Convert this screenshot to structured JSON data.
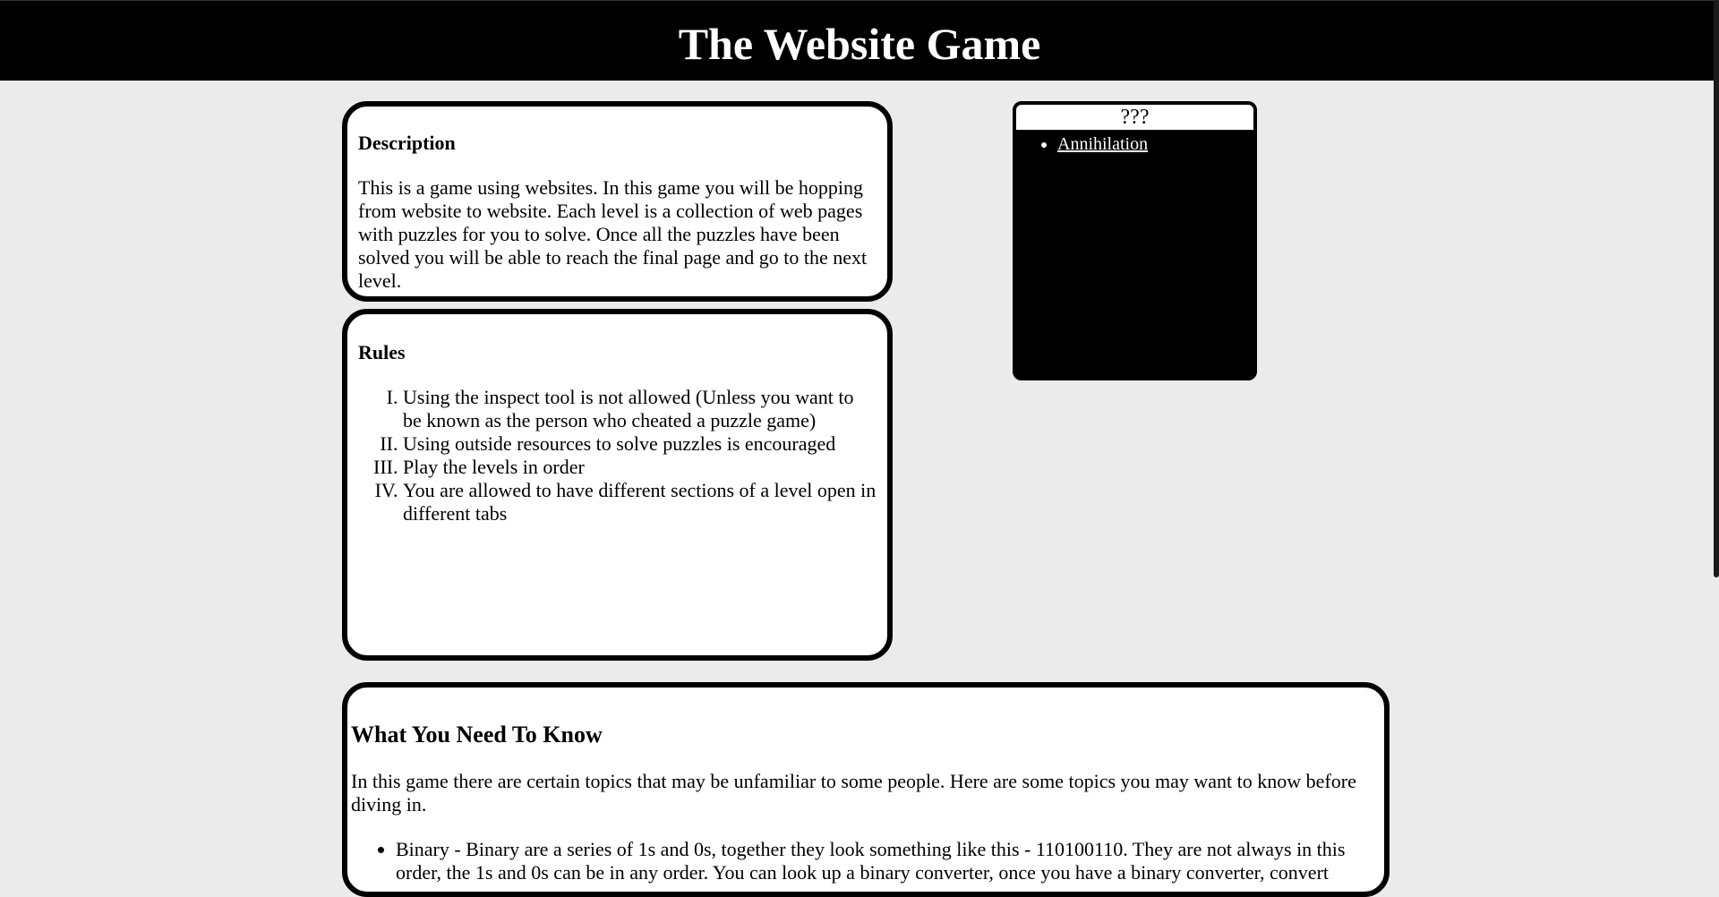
{
  "header": {
    "title": "The Website Game"
  },
  "description": {
    "heading": "Description",
    "text": "This is a game using websites. In this game you will be hopping from website to website. Each level is a collection of web pages with puzzles for you to solve. Once all the puzzles have been solved you will be able to reach the final page and go to the next level."
  },
  "rules": {
    "heading": "Rules",
    "items": [
      "Using the inspect tool is not allowed (Unless you want to be known as the person who cheated a puzzle game)",
      "Using outside resources to solve puzzles is encouraged",
      "Play the levels in order",
      "You are allowed to have different sections of a level open in different tabs"
    ]
  },
  "levels_box": {
    "title": "???",
    "links": [
      "Annihilation"
    ]
  },
  "know": {
    "heading": "What You Need To Know",
    "intro": "In this game there are certain topics that may be unfamiliar to some people. Here are some topics you may want to know before diving in.",
    "items": [
      "Binary - Binary are a series of 1s and 0s, together they look something like this - 110100110. They are not always in this order, the 1s and 0s can be in any order. You can look up a binary converter, once you have a binary converter, convert"
    ]
  },
  "colors": {
    "background": "#ebebeb",
    "header": "#000000",
    "card": "#ffffff",
    "border": "#000000"
  }
}
